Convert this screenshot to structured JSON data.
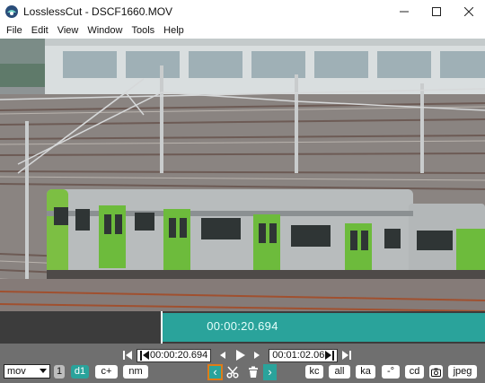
{
  "window": {
    "title": "LosslessCut - DSCF1660.MOV",
    "controls": {
      "minimize": "—",
      "maximize": "☐",
      "close": "✕"
    }
  },
  "menu": [
    "File",
    "Edit",
    "View",
    "Window",
    "Tools",
    "Help"
  ],
  "timeline": {
    "current_time_label": "00:00:20.694",
    "colors": {
      "track": "#3c3c3c",
      "cut_segment": "#2aa39b",
      "playhead": "#ffffff"
    }
  },
  "controls": {
    "cut_start_time": "00:00:20.694",
    "cut_end_time": "00:01:02.06",
    "nav": {
      "jump_start_icon": "jump-to-start-icon",
      "seek_back_icon": "step-backward-icon",
      "play_icon": "play-icon",
      "seek_forward_icon": "step-forward-icon",
      "jump_end_icon": "jump-to-end-icon"
    },
    "format": "mov",
    "left_buttons": [
      {
        "label": "1",
        "style": "gray"
      },
      {
        "label": "d1",
        "style": "teal"
      },
      {
        "label": "c+",
        "style": "white"
      },
      {
        "label": "nm",
        "style": "white"
      }
    ],
    "center_buttons": {
      "set_start": "‹",
      "set_end": "›",
      "cut_icon": "scissors-icon",
      "delete_icon": "trash-icon"
    },
    "right_buttons": [
      {
        "label": "kc"
      },
      {
        "label": "all"
      },
      {
        "label": "ka"
      },
      {
        "label": "-°"
      },
      {
        "label": "cd"
      },
      {
        "label": "camera-icon"
      },
      {
        "label": "jpeg"
      }
    ],
    "colors": {
      "accent": "#2aa39b",
      "panel": "#6f6f6f",
      "focus_outline": "#e07b18"
    }
  }
}
